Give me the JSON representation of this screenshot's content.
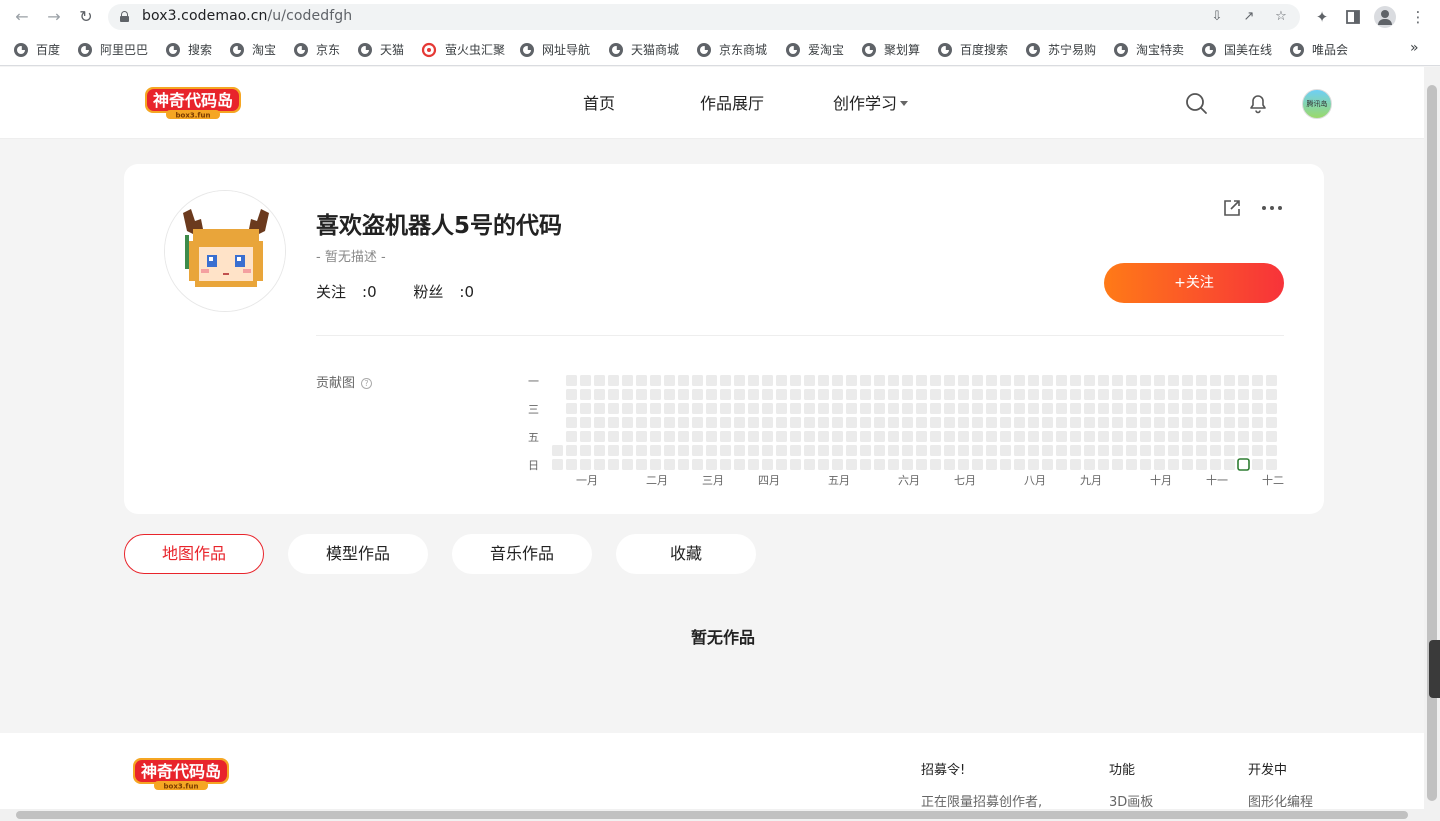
{
  "browser": {
    "url_host": "box3.codemao.cn",
    "url_path": "/u/codedfgh",
    "bookmarks": [
      "百度",
      "阿里巴巴",
      "搜索",
      "淘宝",
      "京东",
      "天猫",
      "萤火虫汇聚",
      "网址导航",
      "天猫商城",
      "京东商城",
      "爱淘宝",
      "聚划算",
      "百度搜索",
      "苏宁易购",
      "淘宝特卖",
      "国美在线",
      "唯品会"
    ],
    "bookmarks_more": "»"
  },
  "header": {
    "logo_text": "神奇代码岛",
    "logo_sub": "box3.fun",
    "nav": [
      "首页",
      "作品展厅",
      "创作学习"
    ],
    "avatar_text": "腾讯岛"
  },
  "profile": {
    "name": "喜欢盗机器人5号的代码",
    "description": "- 暂无描述 -",
    "following_label": "关注",
    "following_count": "0",
    "fans_label": "粉丝",
    "fans_count": "0",
    "follow_button": "+关注",
    "contrib_label": "贡献图",
    "help": "?",
    "weekday_labels": [
      "一",
      "三",
      "五",
      "日"
    ],
    "month_labels": [
      "一月",
      "二月",
      "三月",
      "四月",
      "五月",
      "六月",
      "七月",
      "八月",
      "九月",
      "十月",
      "十一",
      "十二"
    ],
    "contrib_weeks": 52,
    "active_cell": {
      "week": 49,
      "day": 6
    }
  },
  "tabs": [
    "地图作品",
    "模型作品",
    "音乐作品",
    "收藏"
  ],
  "empty_text": "暂无作品",
  "footer": {
    "logo_text": "神奇代码岛",
    "logo_sub": "box3.fun",
    "cols": [
      {
        "title": "招募令!",
        "link": "正在限量招募创作者,"
      },
      {
        "title": "功能",
        "link": "3D画板"
      },
      {
        "title": "开发中",
        "link": "图形化编程"
      }
    ]
  },
  "colors": {
    "brand_red": "#e8242b",
    "follow_gradient_start": "#ff7a17",
    "follow_gradient_end": "#f7333a",
    "contrib_active": "#2e7d32"
  }
}
